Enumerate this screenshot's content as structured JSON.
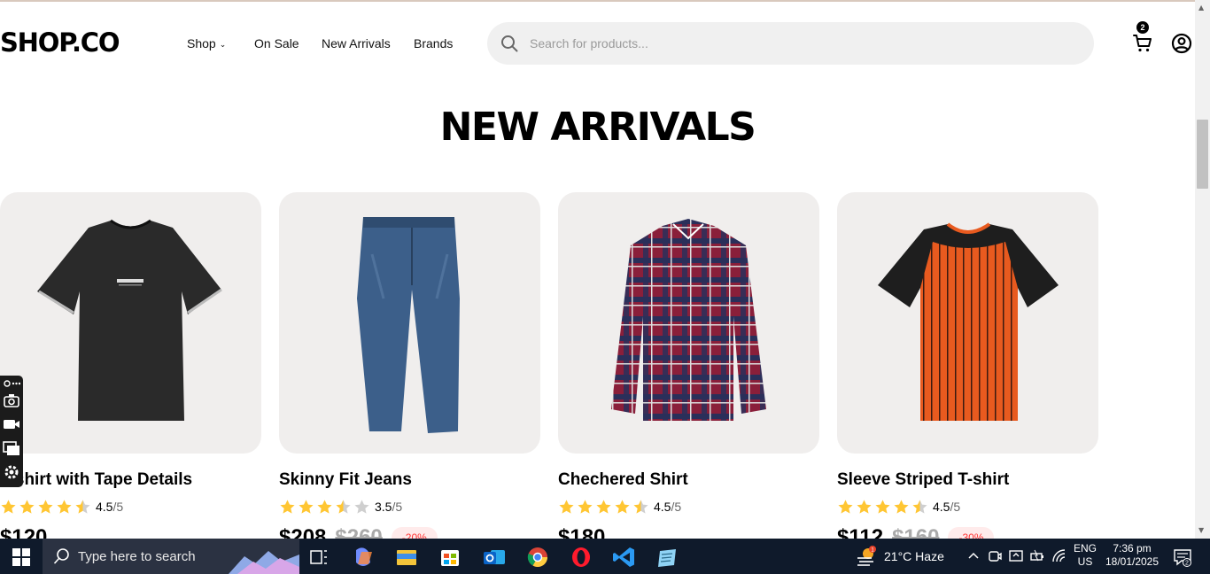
{
  "header": {
    "logo": "SHOP.CO",
    "nav": [
      {
        "label": "Shop",
        "has_dropdown": true
      },
      {
        "label": "On Sale"
      },
      {
        "label": "New Arrivals"
      },
      {
        "label": "Brands"
      }
    ],
    "search": {
      "placeholder": "Search for products..."
    },
    "cart_count": "2"
  },
  "section": {
    "title": "NEW ARRIVALS"
  },
  "products": [
    {
      "name": "T-shirt with Tape Details",
      "rating": 4.5,
      "rating_value": "4.5",
      "rating_max": "/5",
      "price": "$120",
      "old_price": "",
      "discount": ""
    },
    {
      "name": "Skinny Fit Jeans",
      "rating": 3.5,
      "rating_value": "3.5",
      "rating_max": "/5",
      "price": "$208",
      "old_price": "$260",
      "discount": "-20%"
    },
    {
      "name": "Chechered Shirt",
      "rating": 4.5,
      "rating_value": "4.5",
      "rating_max": "/5",
      "price": "$180",
      "old_price": "",
      "discount": ""
    },
    {
      "name": "Sleeve Striped T-shirt",
      "rating": 4.5,
      "rating_value": "4.5",
      "rating_max": "/5",
      "price": "$112",
      "old_price": "$160",
      "discount": "-30%"
    }
  ],
  "colors": {
    "star": "#FFC633",
    "card_bg": "#F0EEED",
    "discount_text": "#FF3333",
    "discount_bg": "#FFEBEB"
  },
  "taskbar": {
    "search_text": "Type here to search",
    "weather": "21°C  Haze",
    "weather_badge": "1",
    "lang_line1": "ENG",
    "lang_line2": "US",
    "time": "7:36 pm",
    "date": "18/01/2025",
    "notification_count": "2"
  }
}
